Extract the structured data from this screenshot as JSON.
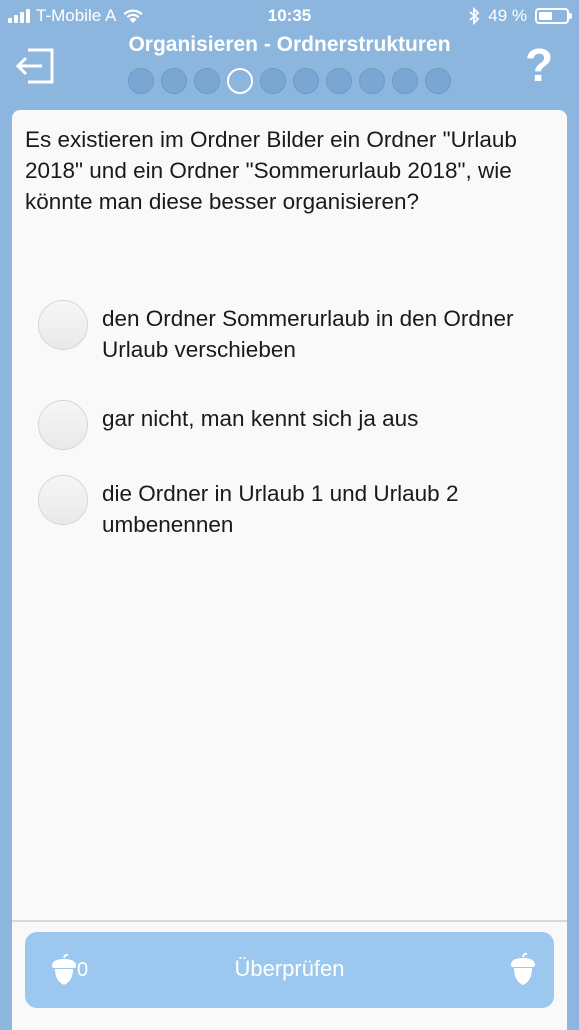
{
  "status_bar": {
    "carrier": "T-Mobile A",
    "time": "10:35",
    "battery_percent": "49 %",
    "battery_level": 0.49
  },
  "header": {
    "title": "Organisieren - Ordnerstrukturen",
    "help_label": "?",
    "progress": {
      "total": 10,
      "current_index": 3
    }
  },
  "question": {
    "text": "Es existieren im Ordner Bilder ein Ordner \"Urlaub 2018\" und ein Ordner \"Sommerurlaub 2018\", wie könnte man diese besser organisieren?",
    "options": [
      {
        "label": "den Ordner Sommerurlaub in den Ordner Urlaub verschieben",
        "selected": false
      },
      {
        "label": "gar nicht, man kennt sich ja aus",
        "selected": false
      },
      {
        "label": "die Ordner in Urlaub 1 und Urlaub 2 umbenennen",
        "selected": false
      }
    ]
  },
  "footer": {
    "check_label": "Überprüfen",
    "acorn_count": "0"
  },
  "colors": {
    "background": "#8db6de",
    "card": "#f9f9f9",
    "button": "#9cc7ee"
  },
  "icons": {
    "exit": "exit-icon",
    "acorn": "acorn-icon",
    "wifi": "wifi-icon",
    "bluetooth": "bluetooth-icon",
    "battery": "battery-icon",
    "signal": "signal-icon"
  }
}
